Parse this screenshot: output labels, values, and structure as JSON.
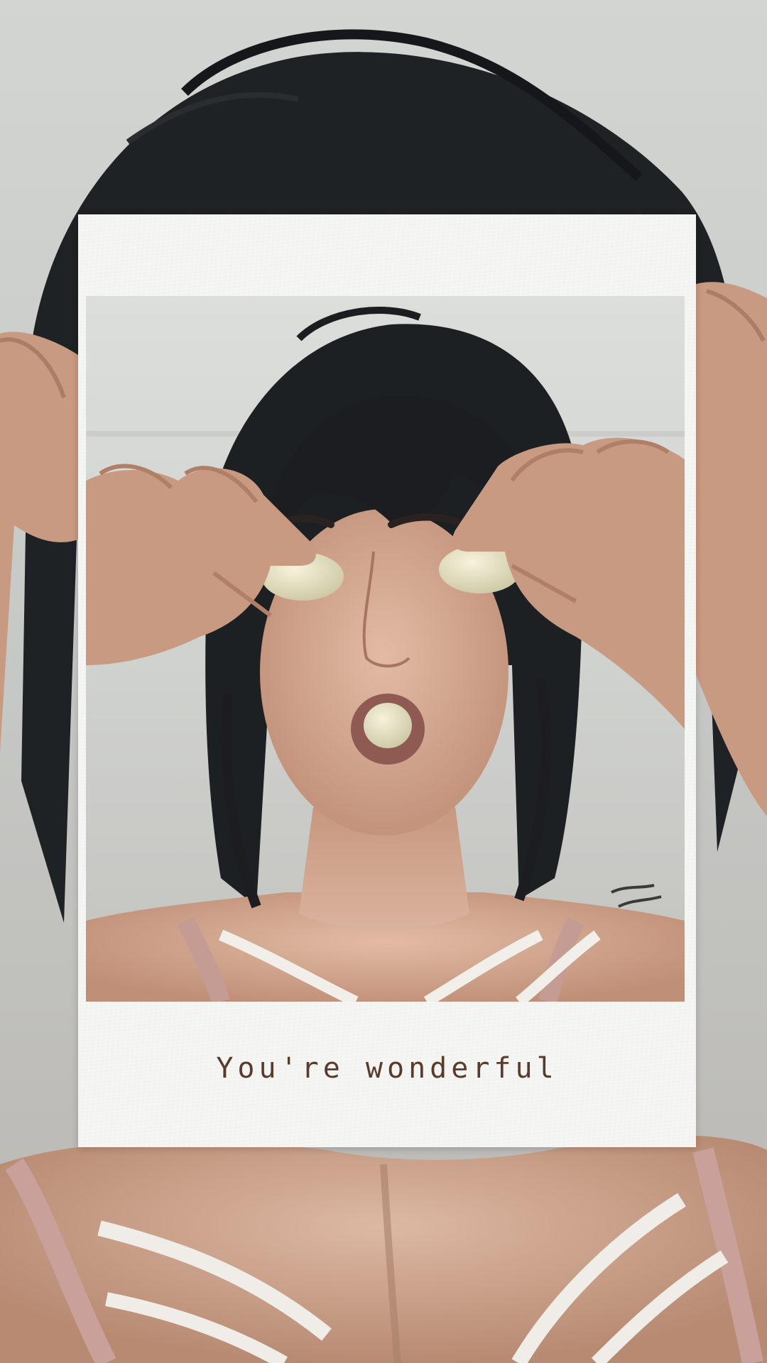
{
  "caption": "You're wonderful",
  "colors": {
    "background_wall": "#c9cbc8",
    "paper": "#f4f4f2",
    "caption_text": "#5a3a2a",
    "hair": "#1c1e20",
    "skin": "#d4a88e",
    "lips": "#8a5a50",
    "candy": "#e6e2c4"
  },
  "scene": {
    "background_image": "woman-holding-candies-background",
    "framed_image": "woman-holding-candies-over-eyes"
  }
}
